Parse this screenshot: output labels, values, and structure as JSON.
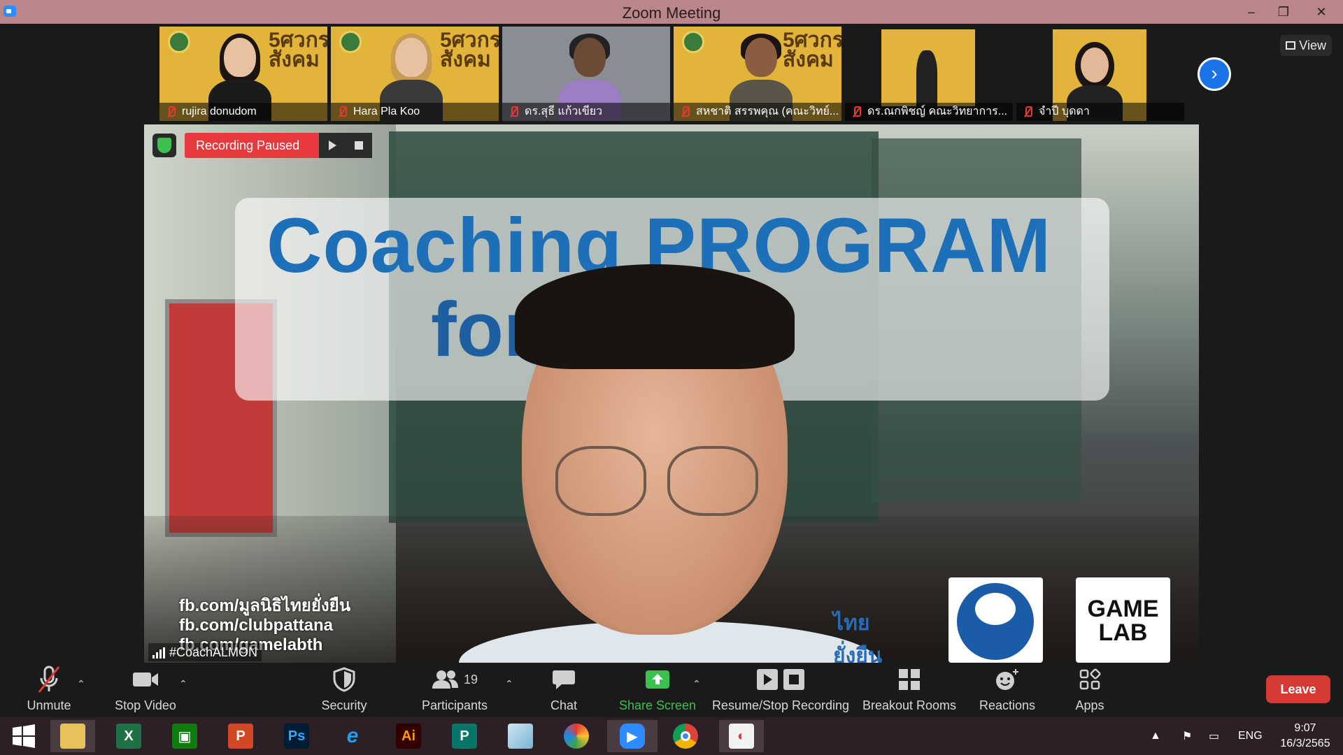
{
  "window": {
    "title": "Zoom Meeting",
    "minimize": "–",
    "restore": "❐",
    "close": "✕"
  },
  "participants_strip": [
    {
      "name": "rujira donudom",
      "muted": true
    },
    {
      "name": "Hara Pla Koo",
      "muted": true
    },
    {
      "name": "ดร.สุธี  แก้วเขียว",
      "muted": true
    },
    {
      "name": "สหชาติ สรรพคุณ (คณะวิทย์...",
      "muted": true
    },
    {
      "name": "ดร.ณกพิชญ์ คณะวิทยาการ...",
      "muted": true
    },
    {
      "name": "จำปี บุดดา",
      "muted": true
    }
  ],
  "poster_text": "5ศวกร สังคม",
  "view_button": "View",
  "recording": {
    "status": "Recording Paused"
  },
  "slide": {
    "headline_line1": "Coaching PROGRAM",
    "headline_line2": "for       urer",
    "social_lines": [
      "fb.com/มูลนิธิไทยยั่งยืน",
      "fb.com/clubpattana",
      "fb.com/gamelabth"
    ],
    "logo_a": "ไทยยั่งยืน",
    "logo_c": "GAME LAB"
  },
  "active_speaker": "#CoachALMON",
  "toolbar": {
    "unmute": "Unmute",
    "stop_video": "Stop Video",
    "security": "Security",
    "participants": "Participants",
    "participants_count": "19",
    "chat": "Chat",
    "share_screen": "Share Screen",
    "recording": "Resume/Stop Recording",
    "breakout": "Breakout Rooms",
    "reactions": "Reactions",
    "apps": "Apps",
    "leave": "Leave"
  },
  "taskbar": {
    "apps": [
      "Start",
      "File Explorer",
      "Excel",
      "Store",
      "PowerPoint",
      "Photoshop",
      "Internet Explorer",
      "Illustrator",
      "Publisher",
      "Notepad",
      "Photoscape",
      "Zoom",
      "Chrome",
      "Photos"
    ],
    "language": "ENG",
    "time": "9:07",
    "date": "16/3/2565"
  },
  "colors": {
    "accent": "#2d8cff",
    "recording": "#e8393e",
    "share": "#3cc04e",
    "leave": "#d43b35",
    "titlebar": "#b9868a"
  }
}
